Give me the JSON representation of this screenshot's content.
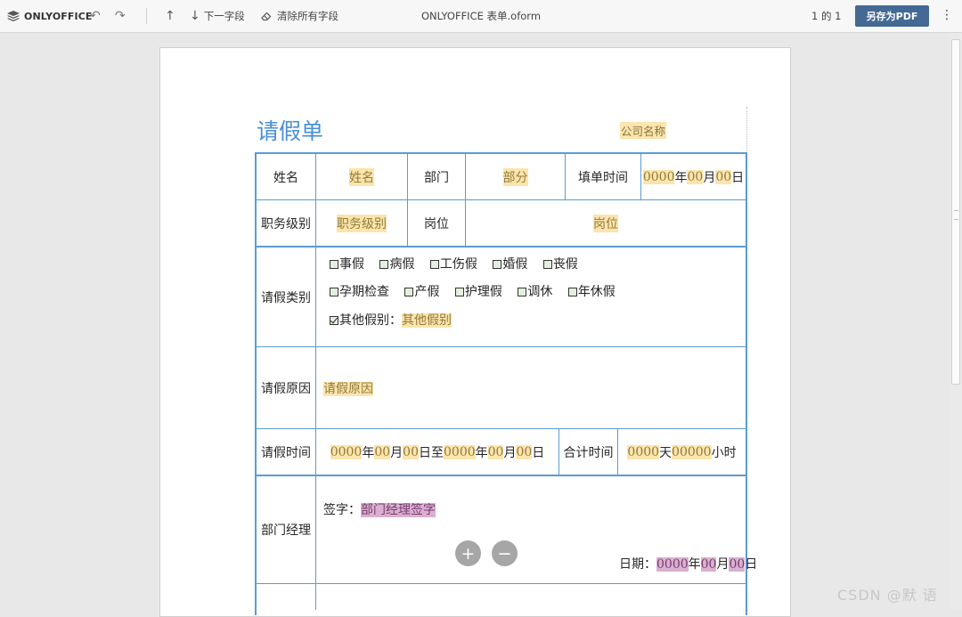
{
  "app": {
    "logo_text": "ONLYOFFICE",
    "doc_title": "ONLYOFFICE 表单.oform",
    "page_counter": "1 的 1",
    "save_pdf": "另存为PDF",
    "next_field": "下一字段",
    "clear_fields": "清除所有字段",
    "icons": [
      "onlyoffice-logo-icon",
      "undo-icon",
      "redo-icon",
      "arrow-up-icon",
      "arrow-down-icon",
      "eraser-icon",
      "more-icon"
    ]
  },
  "form": {
    "title": "请假单",
    "company_placeholder": "公司名称",
    "labels": {
      "name": "姓名",
      "dept": "部门",
      "fill_time": "填单时间",
      "job_level": "职务级别",
      "position": "岗位",
      "leave_type": "请假类别",
      "leave_reason": "请假原因",
      "leave_time": "请假时间",
      "total_time": "合计时间",
      "dept_manager": "部门经理"
    },
    "fields": {
      "name": "姓名",
      "dept": "部分",
      "job_level": "职务级别",
      "position": "岗位",
      "reason": "请假原因",
      "other_leave": "其他假别"
    },
    "date_parts": {
      "year_val": "0000",
      "year": "年",
      "month_val": "00",
      "month": "月",
      "day_val": "00",
      "day": "日",
      "to": "至"
    },
    "total_parts": {
      "days_val": "0000",
      "days": "天",
      "hours_val": "00000",
      "hours": "小时"
    },
    "leave_types_row1": [
      {
        "label": "事假",
        "checked": false
      },
      {
        "label": "病假",
        "checked": false
      },
      {
        "label": "工伤假",
        "checked": false
      },
      {
        "label": "婚假",
        "checked": false
      },
      {
        "label": "丧假",
        "checked": false
      }
    ],
    "leave_types_row2": [
      {
        "label": "孕期检查",
        "checked": false
      },
      {
        "label": "产假",
        "checked": false
      },
      {
        "label": "护理假",
        "checked": false
      },
      {
        "label": "调休",
        "checked": false
      },
      {
        "label": "年休假",
        "checked": false
      }
    ],
    "other_leave_label": "其他假别：",
    "other_checked": true,
    "signature_label": "签字：",
    "signature_placeholder": "部门经理签字",
    "date_label": "日期："
  },
  "watermark": "CSDN @默  语"
}
